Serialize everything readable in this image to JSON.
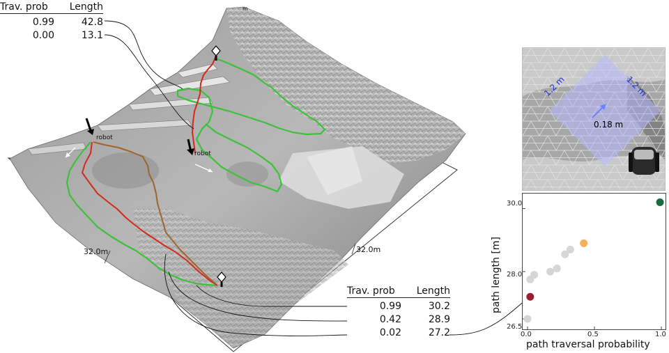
{
  "top_table": {
    "headers": [
      "Trav. prob",
      "Length"
    ],
    "rows": [
      [
        "0.99",
        "42.8"
      ],
      [
        "0.00",
        "13.1"
      ]
    ]
  },
  "bottom_table": {
    "headers": [
      "Trav. prob",
      "Length"
    ],
    "rows": [
      [
        "0.99",
        "30.2"
      ],
      [
        "0.42",
        "28.9"
      ],
      [
        "0.02",
        "27.2"
      ]
    ]
  },
  "terrain": {
    "robot_label": "robot",
    "dim_left": "32.0m",
    "dim_right": "32.0m",
    "dim_top": "m",
    "path_colors": {
      "green": "#3cc23a",
      "red": "#d42a1a",
      "brown": "#a0642a"
    }
  },
  "footprint": {
    "side_a": "1.2 m",
    "side_b": "1.2 m",
    "offset": "0.18 m",
    "label_color": "#1a2fd0"
  },
  "chart_data": {
    "type": "scatter",
    "xlabel": "path traversal probability",
    "ylabel": "path length [m]",
    "xlim": [
      0.0,
      1.0
    ],
    "ylim": [
      26.3,
      30.3
    ],
    "xticks": [
      "0.0",
      "0.5",
      "1.0"
    ],
    "yticks": [
      "26.5",
      "28.0",
      "30.0"
    ],
    "grid": false,
    "points": [
      {
        "x": 0.0,
        "y": 26.5,
        "color": "#d6d6d6"
      },
      {
        "x": 0.02,
        "y": 27.2,
        "color": "#9a1f2e"
      },
      {
        "x": 0.02,
        "y": 27.75,
        "color": "#d6d6d6"
      },
      {
        "x": 0.05,
        "y": 27.9,
        "color": "#d6d6d6"
      },
      {
        "x": 0.17,
        "y": 28.0,
        "color": "#d6d6d6"
      },
      {
        "x": 0.22,
        "y": 28.1,
        "color": "#d6d6d6"
      },
      {
        "x": 0.28,
        "y": 28.55,
        "color": "#d6d6d6"
      },
      {
        "x": 0.32,
        "y": 28.7,
        "color": "#d6d6d6"
      },
      {
        "x": 0.42,
        "y": 28.9,
        "color": "#f2b25a"
      },
      {
        "x": 0.99,
        "y": 30.2,
        "color": "#1a6b3c"
      }
    ]
  }
}
